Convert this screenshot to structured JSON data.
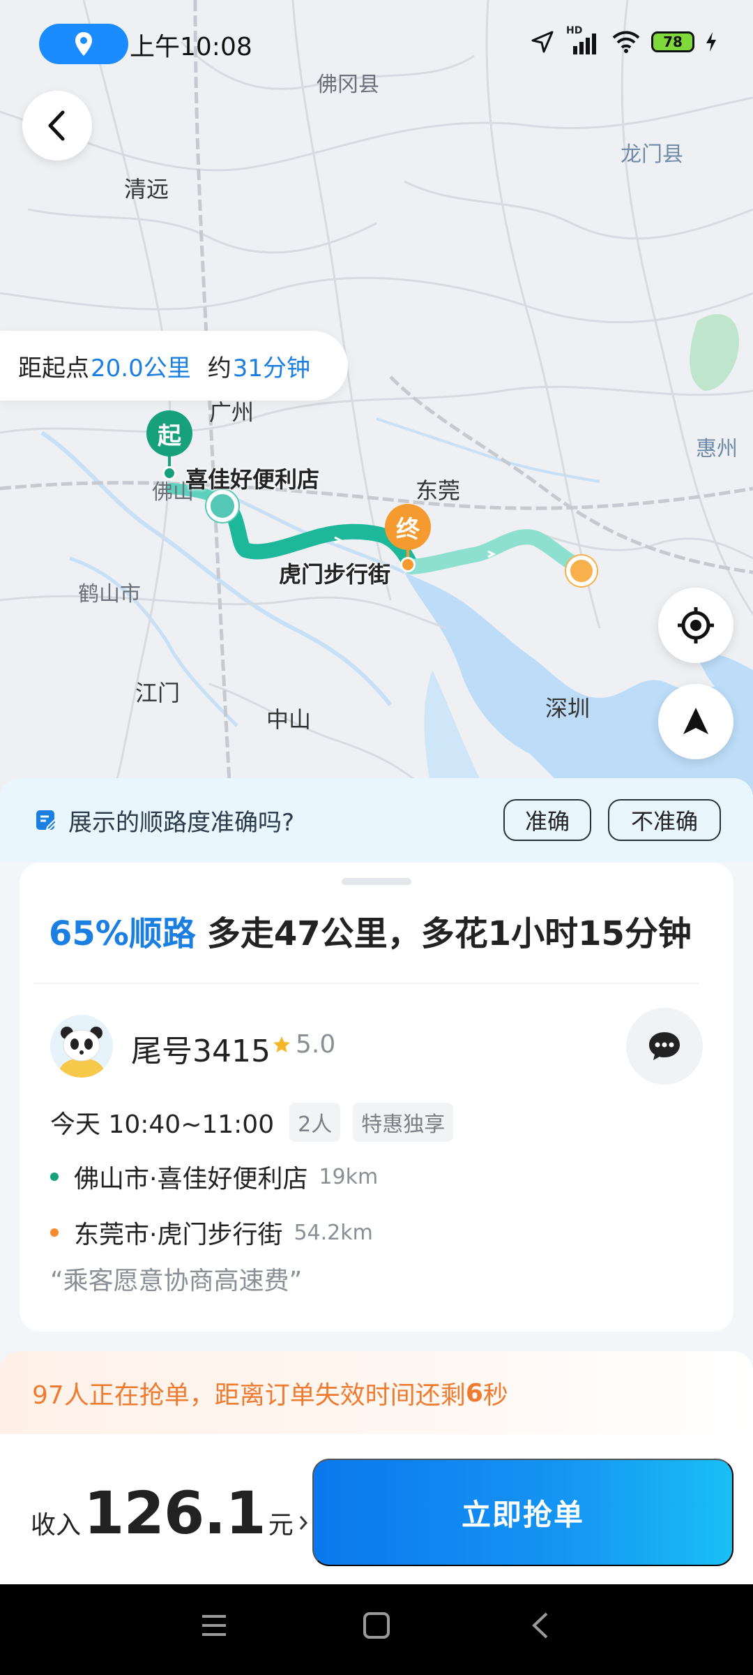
{
  "status_bar": {
    "time": "上午10:08",
    "battery": "78",
    "signal_label": "HD"
  },
  "map": {
    "labels": {
      "foshan_county": "佛冈县",
      "longmen": "龙门县",
      "qingyuan": "清远",
      "guangzhou": "广州",
      "huizhou": "惠州",
      "dongguan": "东莞",
      "heshan": "鹤山市",
      "jiangmen": "江门",
      "zhongshan": "中山",
      "shenzhen": "深圳",
      "foshan": "佛山",
      "pickup_name": "喜佳好便利店",
      "dropoff_name": "虎门步行街"
    },
    "start_marker": "起",
    "end_marker": "终",
    "distance": {
      "prefix": "距起点",
      "km": "20.0公里",
      "about": "约",
      "minutes": "31分钟"
    }
  },
  "feedback": {
    "question": "展示的顺路度准确吗?",
    "accurate": "准确",
    "inaccurate": "不准确"
  },
  "order": {
    "match_percent": "65%顺路",
    "extra": "多走47公里，多花1小时15分钟",
    "passenger": "尾号3415",
    "rating": "5.0",
    "time": "今天 10:40~11:00",
    "tags": [
      "2人",
      "特惠独享"
    ],
    "pickup": {
      "place": "佛山市·喜佳好便利店",
      "distance": "19km"
    },
    "dropoff": {
      "place": "东莞市·虎门步行街",
      "distance": "54.2km"
    },
    "note": "“乘客愿意协商高速费”"
  },
  "grab_info": {
    "prefix": "97人正在抢单，距离订单失效时间还剩",
    "seconds": "6",
    "suffix": "秒"
  },
  "bottom": {
    "income_label": "收入",
    "amount": "126.1",
    "unit": "元",
    "grab_button": "立即抢单"
  },
  "colors": {
    "accent_blue": "#1a7fe0",
    "route_green": "#1db89a",
    "start_green": "#17a07c",
    "end_orange": "#f59a2e",
    "warning_orange": "#ee7b30"
  }
}
